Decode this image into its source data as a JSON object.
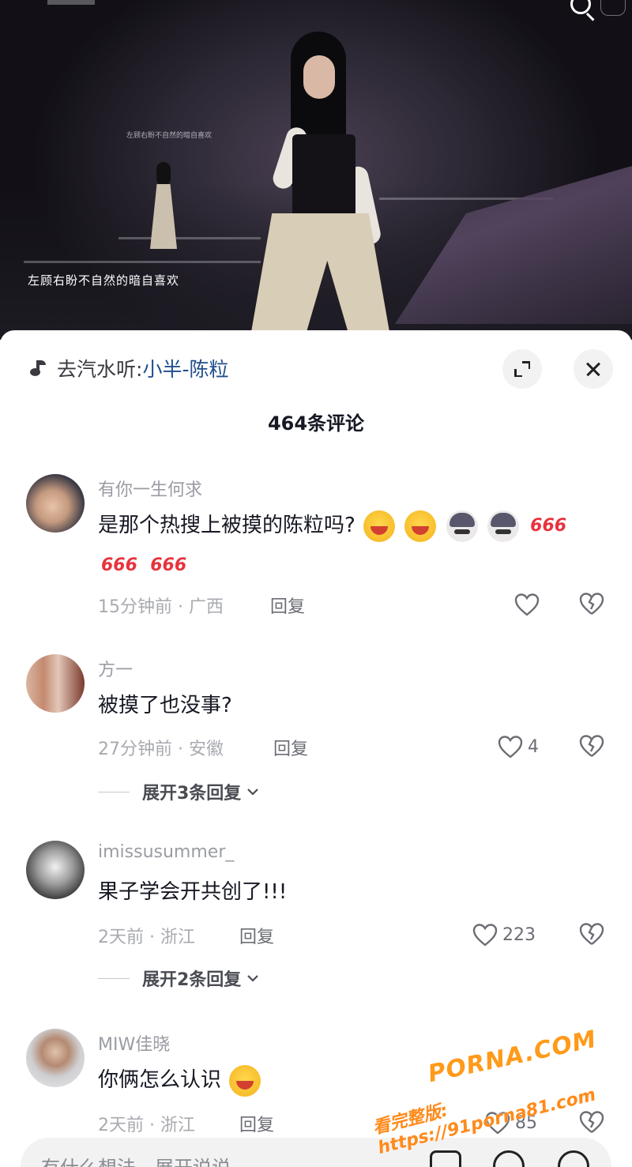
{
  "video": {
    "lyric": "左顾右盼不自然的暗自喜欢",
    "screen_lyric": "左顾右盼不自然的暗自喜欢"
  },
  "music": {
    "prefix": "去汽水听:",
    "song": "小半-陈粒"
  },
  "comments_header": {
    "count_label": "464条评论"
  },
  "comments": [
    {
      "username": "有你一生何求",
      "text": "是那个热搜上被摸的陈粒吗?",
      "time_location": "15分钟前 · 广西",
      "reply_label": "回复",
      "likes": "",
      "emojis": [
        "laughing-crying-emoji",
        "laughing-crying-emoji",
        "husky-emoji",
        "husky-emoji",
        "666",
        "666",
        "666"
      ],
      "six_text": "666"
    },
    {
      "username": "方一",
      "text": "被摸了也没事?",
      "time_location": "27分钟前 · 安徽",
      "reply_label": "回复",
      "likes": "4",
      "expand_label": "展开3条回复"
    },
    {
      "username": "imissusummer_",
      "text": "果子学会开共创了!!!",
      "time_location": "2天前 · 浙江",
      "reply_label": "回复",
      "likes": "223",
      "expand_label": "展开2条回复"
    },
    {
      "username": "MIW佳晓",
      "text": "你俩怎么认识",
      "time_location": "2天前 · 浙江",
      "reply_label": "回复",
      "likes": "85"
    }
  ],
  "input": {
    "placeholder": "有什么想法，展开说说"
  },
  "watermark": {
    "line1": "PORNA.COM",
    "line2": "看完整版: https://91porna81.com"
  },
  "colors": {
    "song_link": "#1f4e8c",
    "six_red": "#e8333d",
    "watermark": "#ff9a1a"
  }
}
